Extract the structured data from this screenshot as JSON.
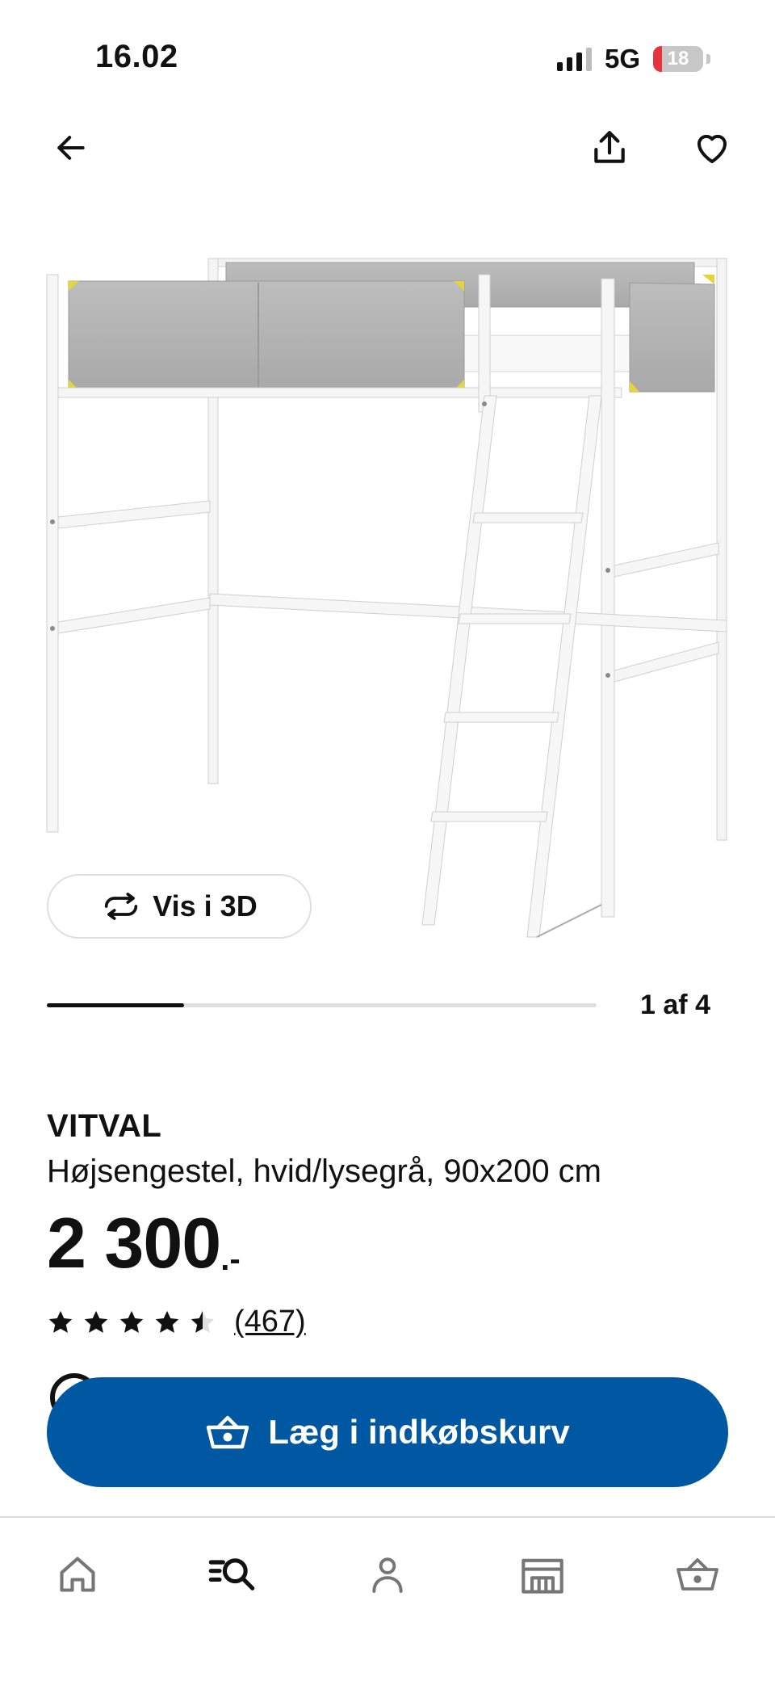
{
  "status_bar": {
    "time": "16.02",
    "network": "5G",
    "battery": "18",
    "battery_level": 0.18,
    "battery_color": "#e5333f"
  },
  "header": {
    "back_icon": "arrow-left-icon",
    "share_icon": "share-icon",
    "favorite_icon": "heart-icon"
  },
  "gallery": {
    "view_3d_label": "Vis i 3D",
    "counter": "1 af 4",
    "current_index": 1,
    "total": 4
  },
  "product": {
    "name": "VITVAL",
    "description": "Højsengestel, hvid/lysegrå, 90x200 cm",
    "price": "2 300",
    "price_suffix": ".-",
    "rating": 4.5,
    "rating_max": 5,
    "review_count": "(467)"
  },
  "actions": {
    "add_to_cart_label": "Læg i indkøbskurv",
    "button_color": "#0058a3"
  },
  "bottom_nav": {
    "items": [
      {
        "name": "home",
        "icon": "home-icon",
        "active": false
      },
      {
        "name": "search",
        "icon": "search-menu-icon",
        "active": true
      },
      {
        "name": "profile",
        "icon": "person-icon",
        "active": false
      },
      {
        "name": "stores",
        "icon": "store-icon",
        "active": false
      },
      {
        "name": "basket",
        "icon": "basket-icon",
        "active": false
      }
    ]
  }
}
